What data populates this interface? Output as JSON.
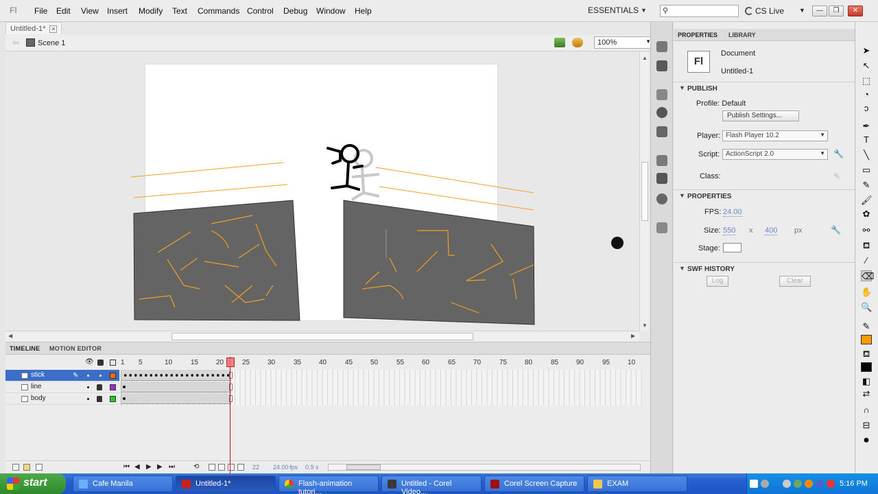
{
  "app": {
    "logo": "Fl"
  },
  "menu": [
    "File",
    "Edit",
    "View",
    "Insert",
    "Modify",
    "Text",
    "Commands",
    "Control",
    "Debug",
    "Window",
    "Help"
  ],
  "workspace": {
    "label": "ESSENTIALS",
    "cslive": "CS Live",
    "search_placeholder": ""
  },
  "window_buttons": {
    "minimize": "—",
    "restore": "❐",
    "close": "✕"
  },
  "document": {
    "tab": "Untitled-1*",
    "scene": "Scene 1",
    "zoom": "100%"
  },
  "stage": {
    "background": "#ffffff",
    "platform_color": "#646464",
    "line_color": "#f0a020"
  },
  "timeline": {
    "tabs": [
      "TIMELINE",
      "MOTION EDITOR"
    ],
    "frame_numbers": [
      "1",
      "5",
      "10",
      "15",
      "20",
      "25",
      "30",
      "35",
      "40",
      "45",
      "50",
      "55",
      "60",
      "65",
      "70",
      "75",
      "80",
      "85",
      "90",
      "95",
      "10"
    ],
    "layers": [
      {
        "name": "stick",
        "color": "#ff6a00",
        "selected": true
      },
      {
        "name": "line",
        "color": "#9b2fd0",
        "selected": false
      },
      {
        "name": "body",
        "color": "#1fd01f",
        "selected": false
      }
    ],
    "current_frame": "22",
    "fps": "24.00",
    "fps_unit": "fps",
    "time": "0.9 s"
  },
  "properties": {
    "tabs": [
      "PROPERTIES",
      "LIBRARY"
    ],
    "doc_icon": "Fl",
    "doc_type": "Document",
    "doc_name": "Untitled-1",
    "publish": {
      "title": "PUBLISH",
      "profile": "Profile: Default",
      "settings_button": "Publish Settings...",
      "player_label": "Player:",
      "player": "Flash Player 10.2",
      "script_label": "Script:",
      "script": "ActionScript 2.0",
      "class_label": "Class:"
    },
    "props": {
      "title": "PROPERTIES",
      "fps_label": "FPS:",
      "fps": "24.00",
      "size_label": "Size:",
      "width": "550",
      "x": "x",
      "height": "400",
      "unit": "px",
      "stage_label": "Stage:"
    },
    "swf_history": {
      "title": "SWF HISTORY",
      "log": "Log",
      "clear": "Clear"
    }
  },
  "taskbar": {
    "start": "start",
    "tasks": [
      "Cafe Manila",
      "Untitled-1*",
      "Flash-animation tutori...",
      "Untitled - Corel Video...",
      "Corel Screen Capture",
      "EXAM"
    ],
    "clock": "5:16 PM"
  }
}
